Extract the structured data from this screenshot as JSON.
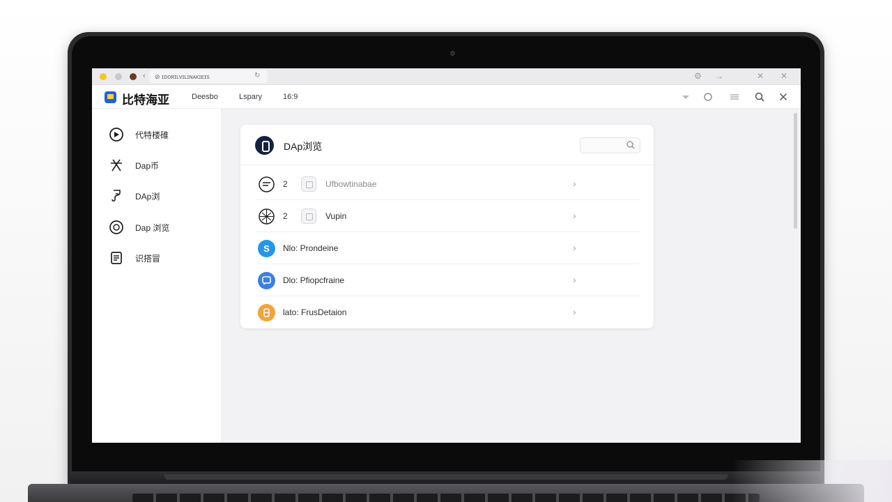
{
  "window": {
    "address": "⊘ ɪᴅᴏʀɪʟᴠɪʟɪɴᴀᴋɪᴇɪs",
    "back_glyph": "‹",
    "reload_glyph": "↻",
    "controls": [
      "⚙",
      "→",
      "✕",
      "✕"
    ],
    "traffic_lights": [
      "#f3c623",
      "#c9c9cc",
      "#6b3a1f"
    ]
  },
  "appbar": {
    "brand": "比特海亚",
    "menu": [
      "Deesbo",
      "Lspary",
      "16:9"
    ],
    "icons": [
      "chevron-down-icon",
      "circle-icon",
      "menu-icon",
      "search-icon",
      "close-icon"
    ]
  },
  "sidebar": {
    "items": [
      {
        "label": "代特楼碓",
        "icon": "target-icon"
      },
      {
        "label": "Dap币",
        "icon": "network-icon"
      },
      {
        "label": "DAp浏",
        "icon": "script-icon"
      },
      {
        "label": "Dap 浏览",
        "icon": "compass-icon"
      },
      {
        "label": "识搭冒",
        "icon": "document-icon"
      }
    ]
  },
  "card": {
    "title": "DAp浏览",
    "rows": [
      {
        "num": "2",
        "text": "Ufbowtinabae",
        "style": "plain",
        "muted": true
      },
      {
        "num": "2",
        "text": "Vupin",
        "style": "plain",
        "muted": false
      },
      {
        "text": "Nlo: Prondeine",
        "style": "badge",
        "color": "#2596e8"
      },
      {
        "text": "Dlo: Pfiopcfraine",
        "style": "badge",
        "color": "#3d7ee3"
      },
      {
        "text": "lato: FrusDetaion",
        "style": "badge",
        "color": "#f2a33a"
      }
    ],
    "chevron": "›"
  },
  "accent_color": "#1f63d6"
}
